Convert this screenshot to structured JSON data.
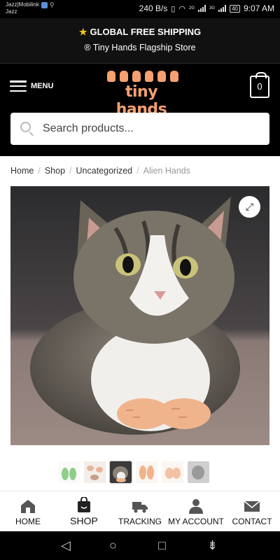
{
  "status_bar": {
    "carrier_line1": "Jazz|Mobilink",
    "carrier_line2": "Jazz",
    "net_speed": "240 B/s",
    "signal1_label": "2G",
    "signal2_label": "3G",
    "battery": "40",
    "time": "9:07 AM"
  },
  "promo": {
    "shipping": "GLOBAL FREE SHIPPING",
    "store": "® Tiny Hands Flagship Store"
  },
  "header": {
    "menu_label": "MENU",
    "logo_text": "tiny hands",
    "cart_count": "0",
    "search_placeholder": "Search products..."
  },
  "breadcrumb": [
    "Home",
    "Shop",
    "Uncategorized",
    "Alien Hands"
  ],
  "product": {
    "zoom_icon": "expand-icon",
    "thumbnail_count": 6,
    "active_thumbnail": 3
  },
  "bottom_nav": [
    {
      "label": "HOME",
      "icon": "home-icon"
    },
    {
      "label": "SHOP",
      "icon": "shopping-bag-icon"
    },
    {
      "label": "TRACKING",
      "icon": "truck-icon"
    },
    {
      "label": "MY ACCOUNT",
      "icon": "user-icon"
    },
    {
      "label": "CONTACT",
      "icon": "envelope-icon"
    }
  ],
  "colors": {
    "brand_orange": "#f4a070",
    "header_bg": "#000000"
  }
}
